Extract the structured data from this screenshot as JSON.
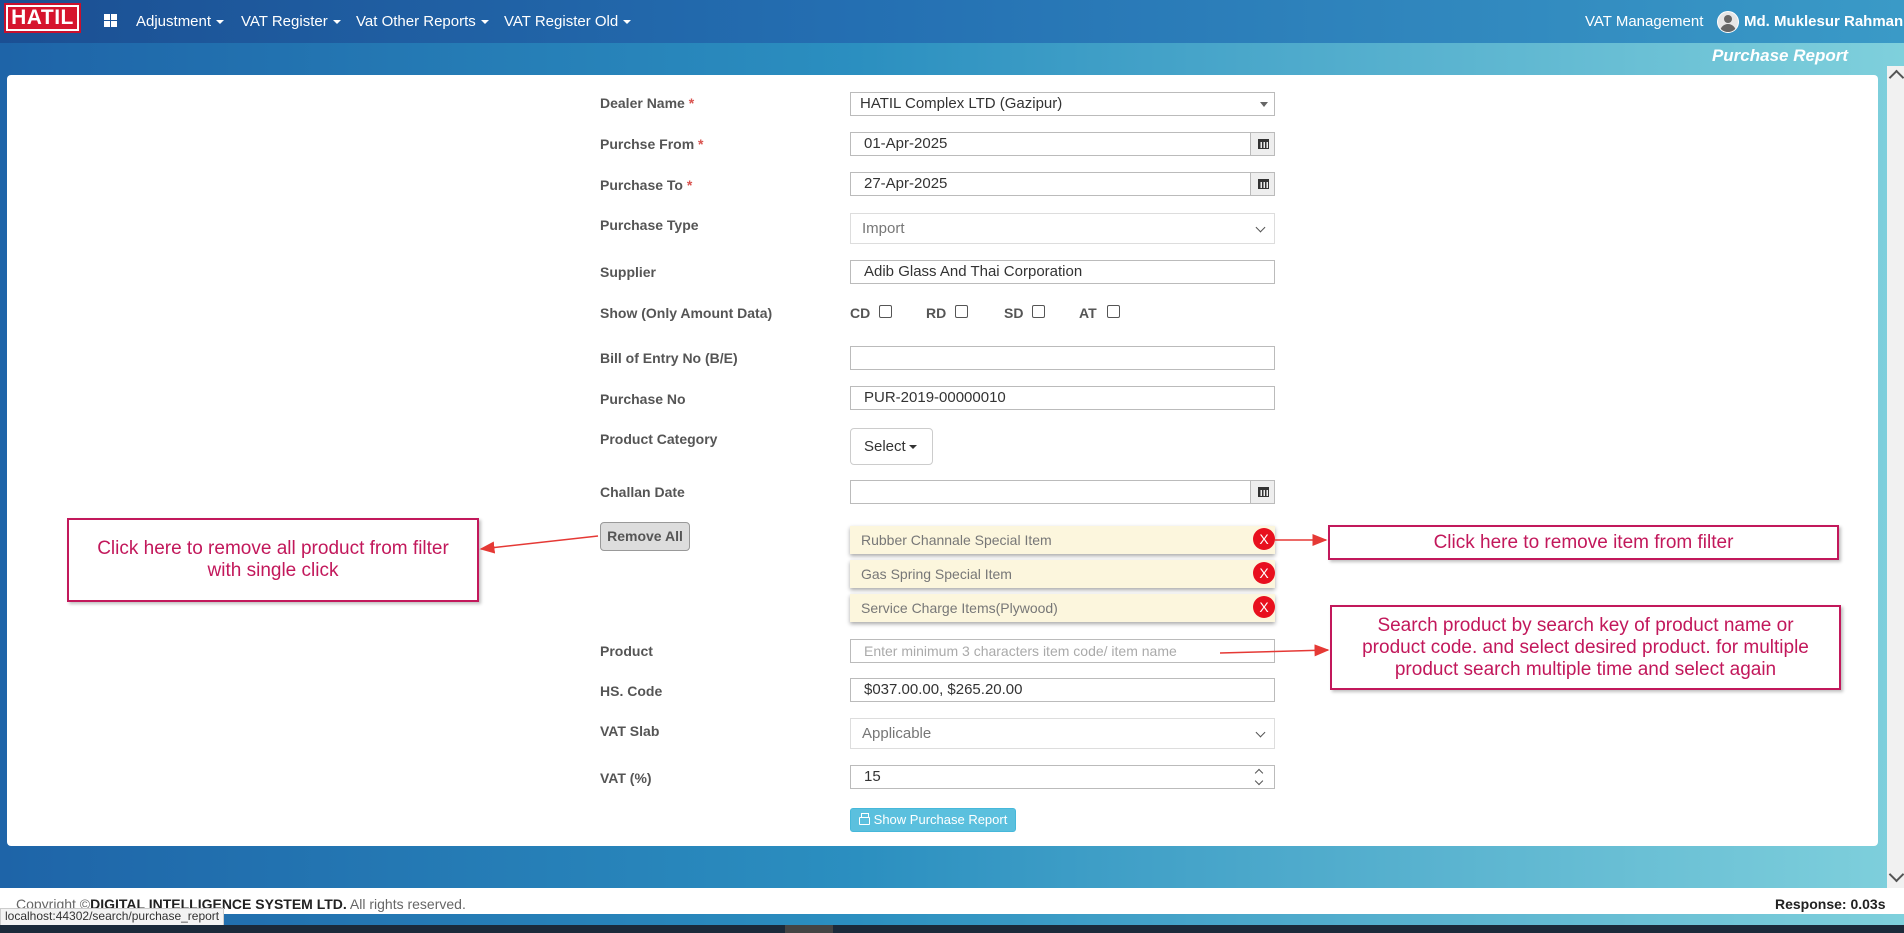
{
  "nav": {
    "logo": "HATIL",
    "menus": [
      "Adjustment",
      "VAT Register",
      "Vat Other Reports",
      "VAT Register Old"
    ],
    "module": "VAT Management",
    "user": "Md. Muklesur Rahman"
  },
  "page_title": "Purchase Report",
  "form": {
    "dealer": {
      "label": "Dealer Name",
      "value": "HATIL Complex LTD (Gazipur)"
    },
    "purchase_from": {
      "label": "Purchse From",
      "value": "01-Apr-2025"
    },
    "purchase_to": {
      "label": "Purchase To",
      "value": "27-Apr-2025"
    },
    "purchase_type": {
      "label": "Purchase Type",
      "value": "Import"
    },
    "supplier": {
      "label": "Supplier",
      "value": "Adib Glass And Thai Corporation"
    },
    "show_amount": {
      "label": "Show (Only Amount Data)",
      "options": [
        "CD",
        "RD",
        "SD",
        "AT"
      ]
    },
    "bill_of_entry": {
      "label": "Bill of Entry No (B/E)",
      "value": ""
    },
    "purchase_no": {
      "label": "Purchase No",
      "value": "PUR-2019-00000010"
    },
    "product_category": {
      "label": "Product Category",
      "value": "Select"
    },
    "challan_date": {
      "label": "Challan Date",
      "value": ""
    },
    "remove_all": "Remove All",
    "selected_items": [
      "Rubber Channale Special Item",
      "Gas Spring Special Item",
      "Service Charge Items(Plywood)"
    ],
    "remove_item": "X",
    "product": {
      "label": "Product",
      "placeholder": "Enter minimum 3 characters item code/ item name"
    },
    "hs_code": {
      "label": "HS. Code",
      "value": "$037.00.00, $265.20.00"
    },
    "vat_slab": {
      "label": "VAT Slab",
      "value": "Applicable"
    },
    "vat_percent": {
      "label": "VAT (%)",
      "value": "15"
    },
    "show_button": "Show Purchase Report"
  },
  "callouts": {
    "remove_all": "Click here to remove all product from filter with single click",
    "remove_item": "Click here to remove item from filter",
    "search": "Search product by search key of product name or product code. and select desired product. for multiple product search multiple time and select again"
  },
  "footer": {
    "copyright_prefix": "Copyright ©",
    "company": "DIGITAL INTELLIGENCE SYSTEM LTD.",
    "rights": " All rights reserved.",
    "response": "Response: 0.03s"
  },
  "status_url": "localhost:44302/search/purchase_report",
  "colors": {
    "accent": "#1e64a8",
    "callout": "#c2185b",
    "remove_red": "#e8101e",
    "info_button": "#5bc0de",
    "item_bg": "#fcf6dd"
  }
}
